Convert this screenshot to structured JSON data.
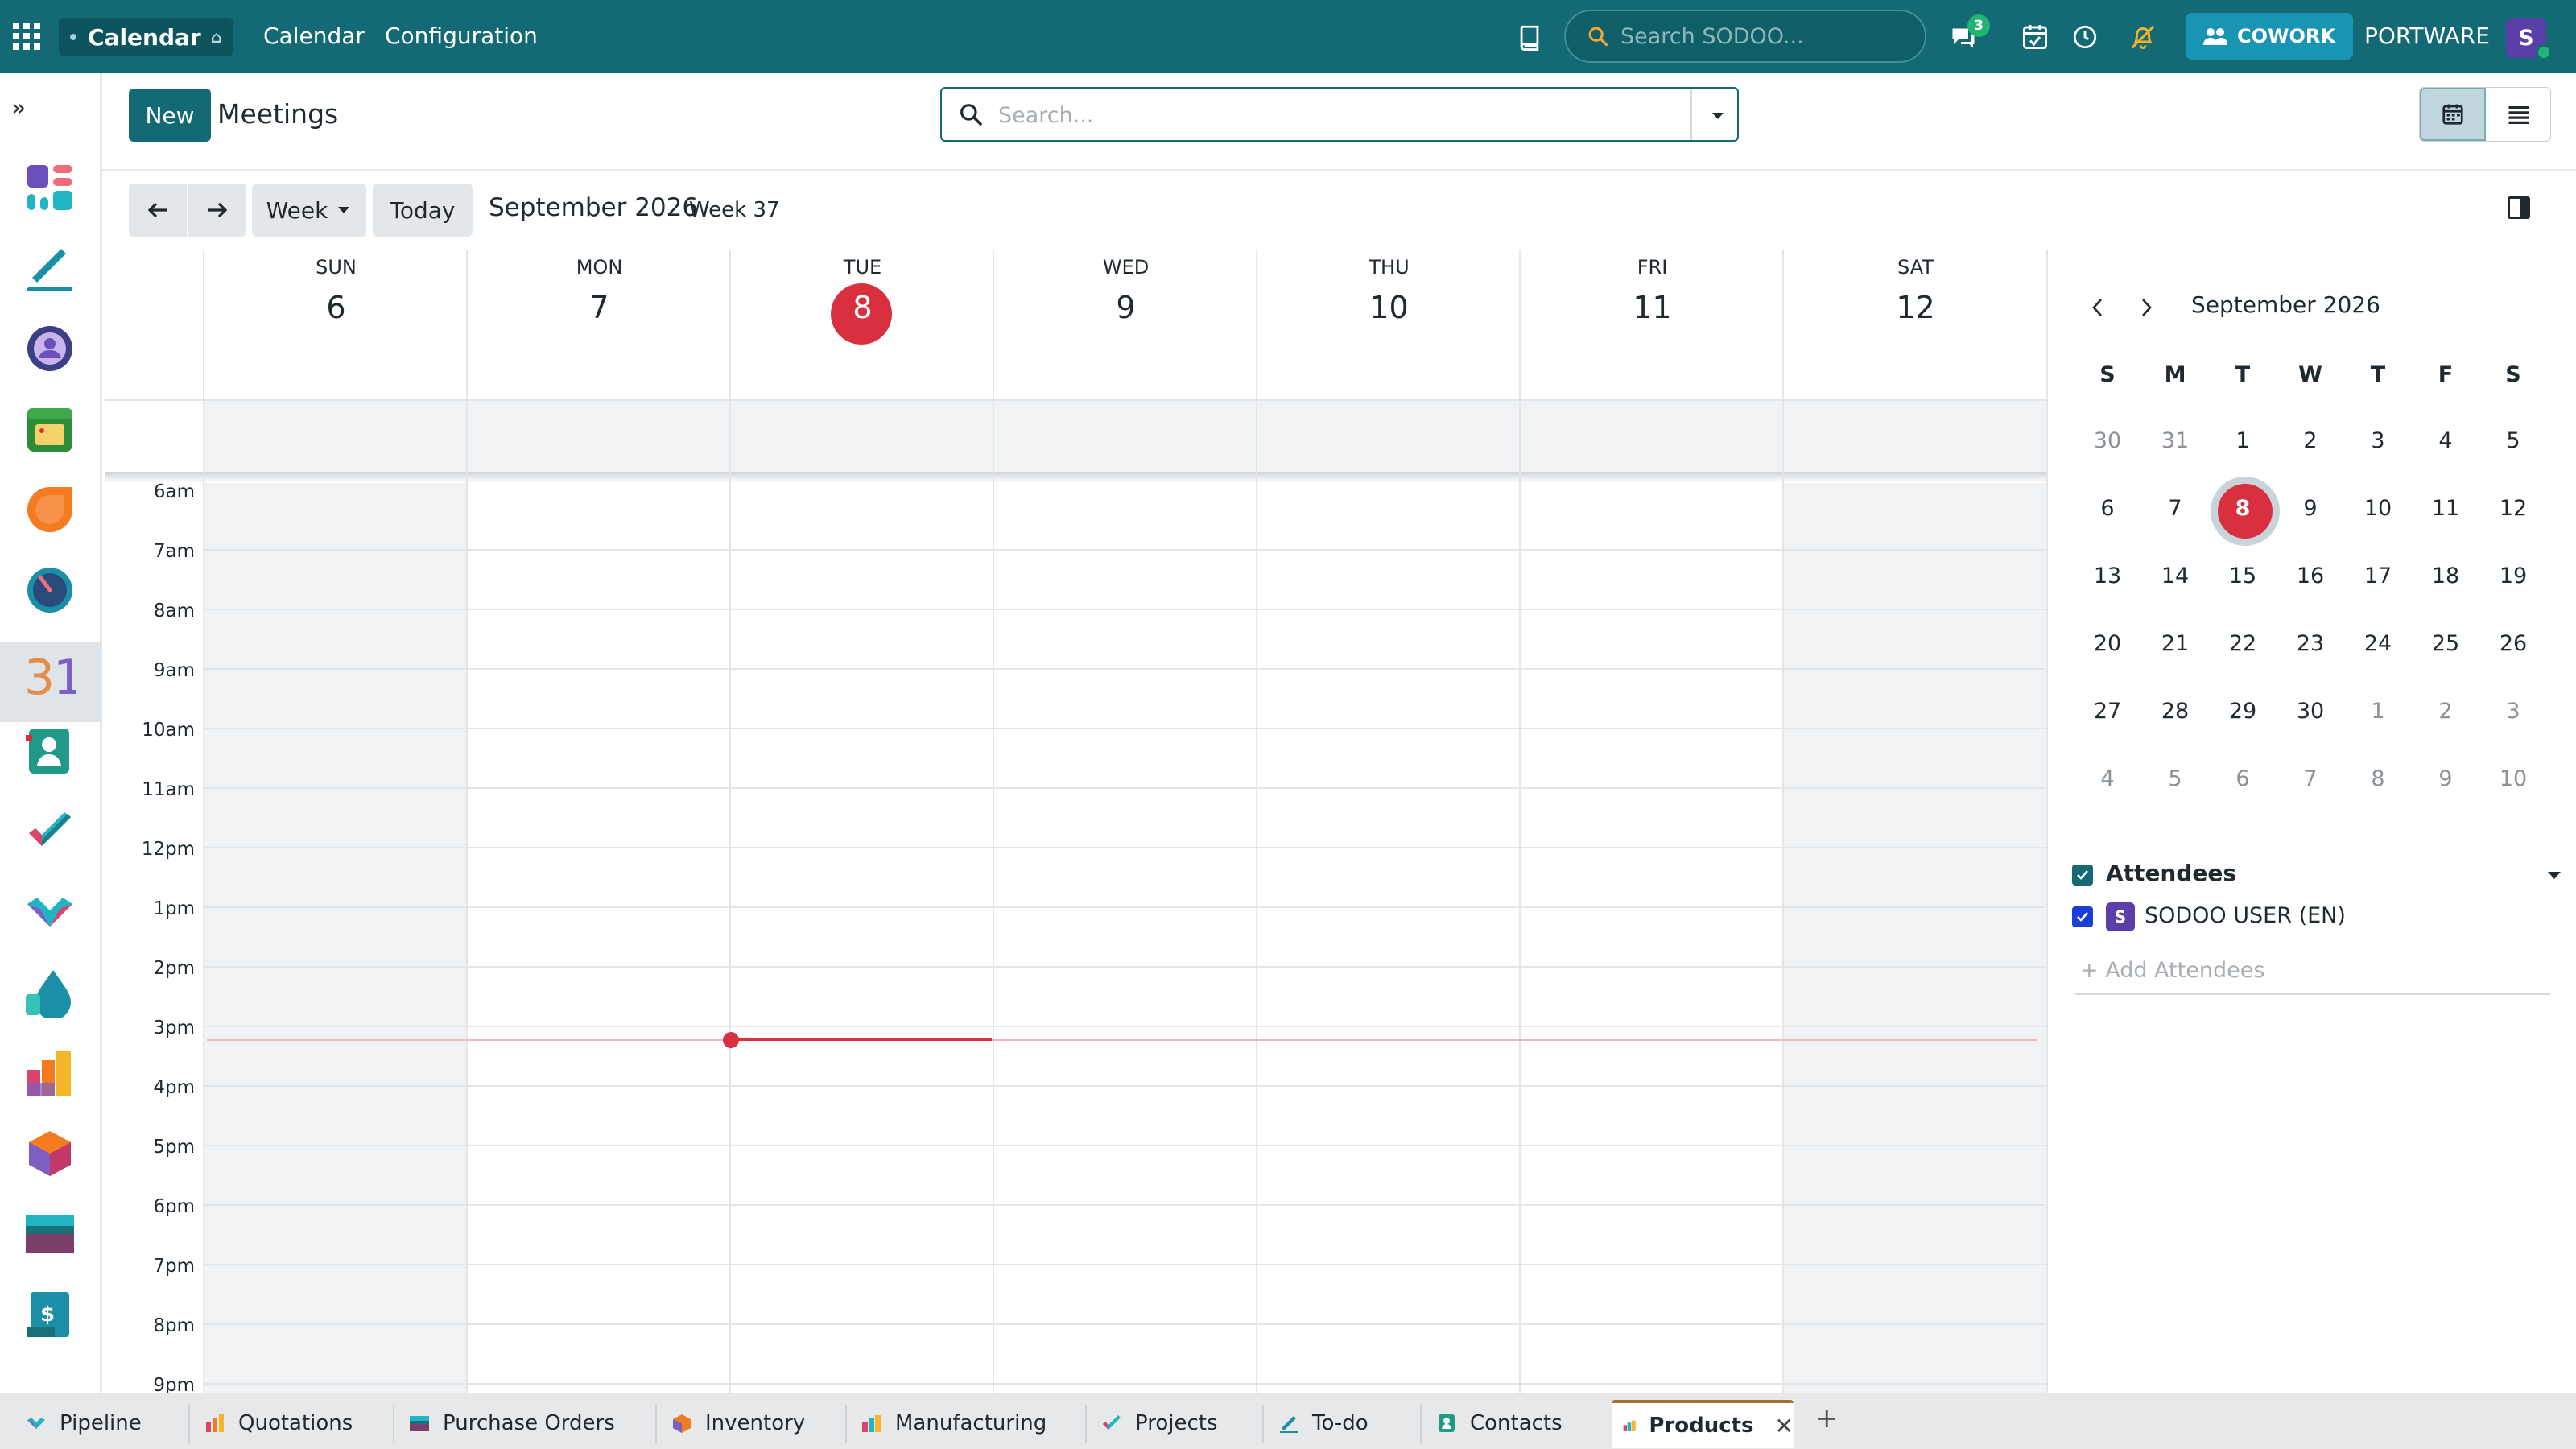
{
  "topbar": {
    "app_name": "Calendar",
    "menu": [
      "Calendar",
      "Configuration"
    ],
    "search_placeholder": "Search SODOO...",
    "messages_badge": "3",
    "cowork_label": "COWORK",
    "company": "PORTWARE",
    "avatar_letter": "S",
    "colors": {
      "bar": "#136974",
      "cowork": "#1a94b3"
    }
  },
  "sidebar": {
    "apps": [
      "dashboard-app-icon",
      "sign-app-icon",
      "community-app-icon",
      "calendar-app-icon",
      "discuss-app-icon",
      "timesheet-app-icon",
      "calendar-31-app-icon",
      "contacts-app-icon",
      "todo-app-icon",
      "crm-app-icon",
      "drop-app-icon",
      "manufacturing-app-icon",
      "inventory-app-icon",
      "purchase-app-icon",
      "invoicing-app-icon"
    ]
  },
  "control": {
    "new_label": "New",
    "title": "Meetings",
    "search_placeholder": "Search..."
  },
  "toolbar": {
    "scale_label": "Week",
    "today_label": "Today",
    "period": "September 2026",
    "week": "Week 37"
  },
  "week": {
    "days": [
      {
        "name": "SUN",
        "num": "6"
      },
      {
        "name": "MON",
        "num": "7"
      },
      {
        "name": "TUE",
        "num": "8"
      },
      {
        "name": "WED",
        "num": "9"
      },
      {
        "name": "THU",
        "num": "10"
      },
      {
        "name": "FRI",
        "num": "11"
      },
      {
        "name": "SAT",
        "num": "12"
      }
    ],
    "hours": [
      "6am",
      "7am",
      "8am",
      "9am",
      "10am",
      "11am",
      "12pm",
      "1pm",
      "2pm",
      "3pm",
      "4pm",
      "5pm",
      "6pm",
      "7pm",
      "8pm",
      "9pm"
    ],
    "today_color": "#d8303f"
  },
  "mini_calendar": {
    "title": "September 2026",
    "dow": [
      "S",
      "M",
      "T",
      "W",
      "T",
      "F",
      "S"
    ],
    "weeks": [
      [
        "30",
        "31",
        "1",
        "2",
        "3",
        "4",
        "5"
      ],
      [
        "6",
        "7",
        "8",
        "9",
        "10",
        "11",
        "12"
      ],
      [
        "13",
        "14",
        "15",
        "16",
        "17",
        "18",
        "19"
      ],
      [
        "20",
        "21",
        "22",
        "23",
        "24",
        "25",
        "26"
      ],
      [
        "27",
        "28",
        "29",
        "30",
        "1",
        "2",
        "3"
      ],
      [
        "4",
        "5",
        "6",
        "7",
        "8",
        "9",
        "10"
      ]
    ]
  },
  "attendees": {
    "title": "Attendees",
    "items": [
      {
        "avatar": "S",
        "name": "SODOO USER (EN)"
      }
    ],
    "add_placeholder": "+ Add Attendees"
  },
  "tabs": [
    {
      "label": "Pipeline"
    },
    {
      "label": "Quotations"
    },
    {
      "label": "Purchase Orders"
    },
    {
      "label": "Inventory"
    },
    {
      "label": "Manufacturing"
    },
    {
      "label": "Projects"
    },
    {
      "label": "To-do"
    },
    {
      "label": "Contacts"
    },
    {
      "label": "Products"
    }
  ]
}
